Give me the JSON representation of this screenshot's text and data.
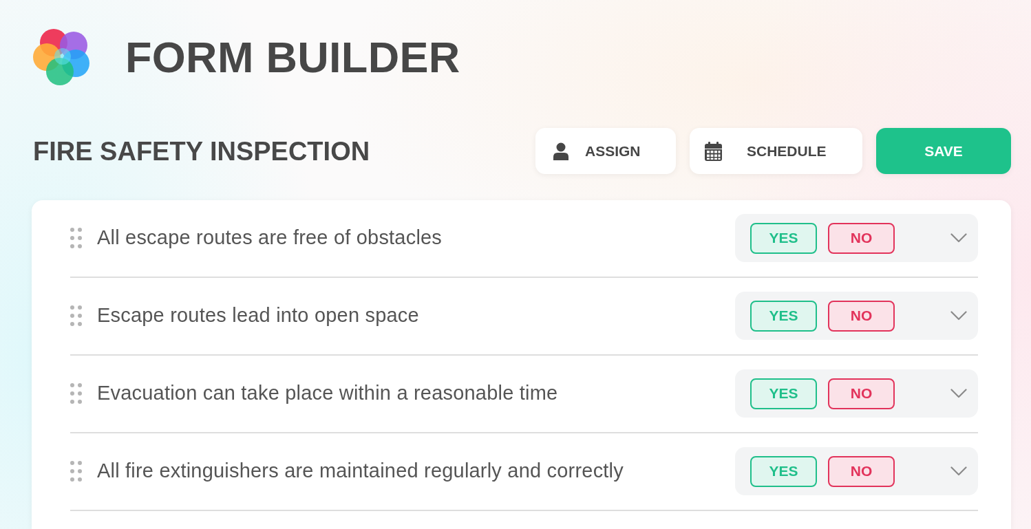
{
  "app": {
    "title": "FORM BUILDER"
  },
  "form": {
    "title": "FIRE SAFETY INSPECTION"
  },
  "actions": {
    "assign": {
      "label": "ASSIGN"
    },
    "schedule": {
      "label": "SCHEDULE"
    },
    "save": {
      "label": "SAVE"
    }
  },
  "questions": [
    {
      "text": "All escape routes are free of obstacles",
      "answers": [
        {
          "label": "YES",
          "color": "#1fbf8a"
        },
        {
          "label": "NO",
          "color": "#e2335b"
        }
      ]
    },
    {
      "text": "Escape routes lead into open space",
      "answers": [
        {
          "label": "YES",
          "color": "#1fbf8a"
        },
        {
          "label": "NO",
          "color": "#e2335b"
        }
      ]
    },
    {
      "text": "Evacuation can take place within a reasonable time",
      "answers": [
        {
          "label": "YES",
          "color": "#1fbf8a"
        },
        {
          "label": "NO",
          "color": "#e2335b"
        }
      ]
    },
    {
      "text": "All fire extinguishers are maintained regularly and correctly",
      "answers": [
        {
          "label": "YES",
          "color": "#1fbf8a"
        },
        {
          "label": "NO",
          "color": "#e2335b"
        }
      ]
    }
  ]
}
